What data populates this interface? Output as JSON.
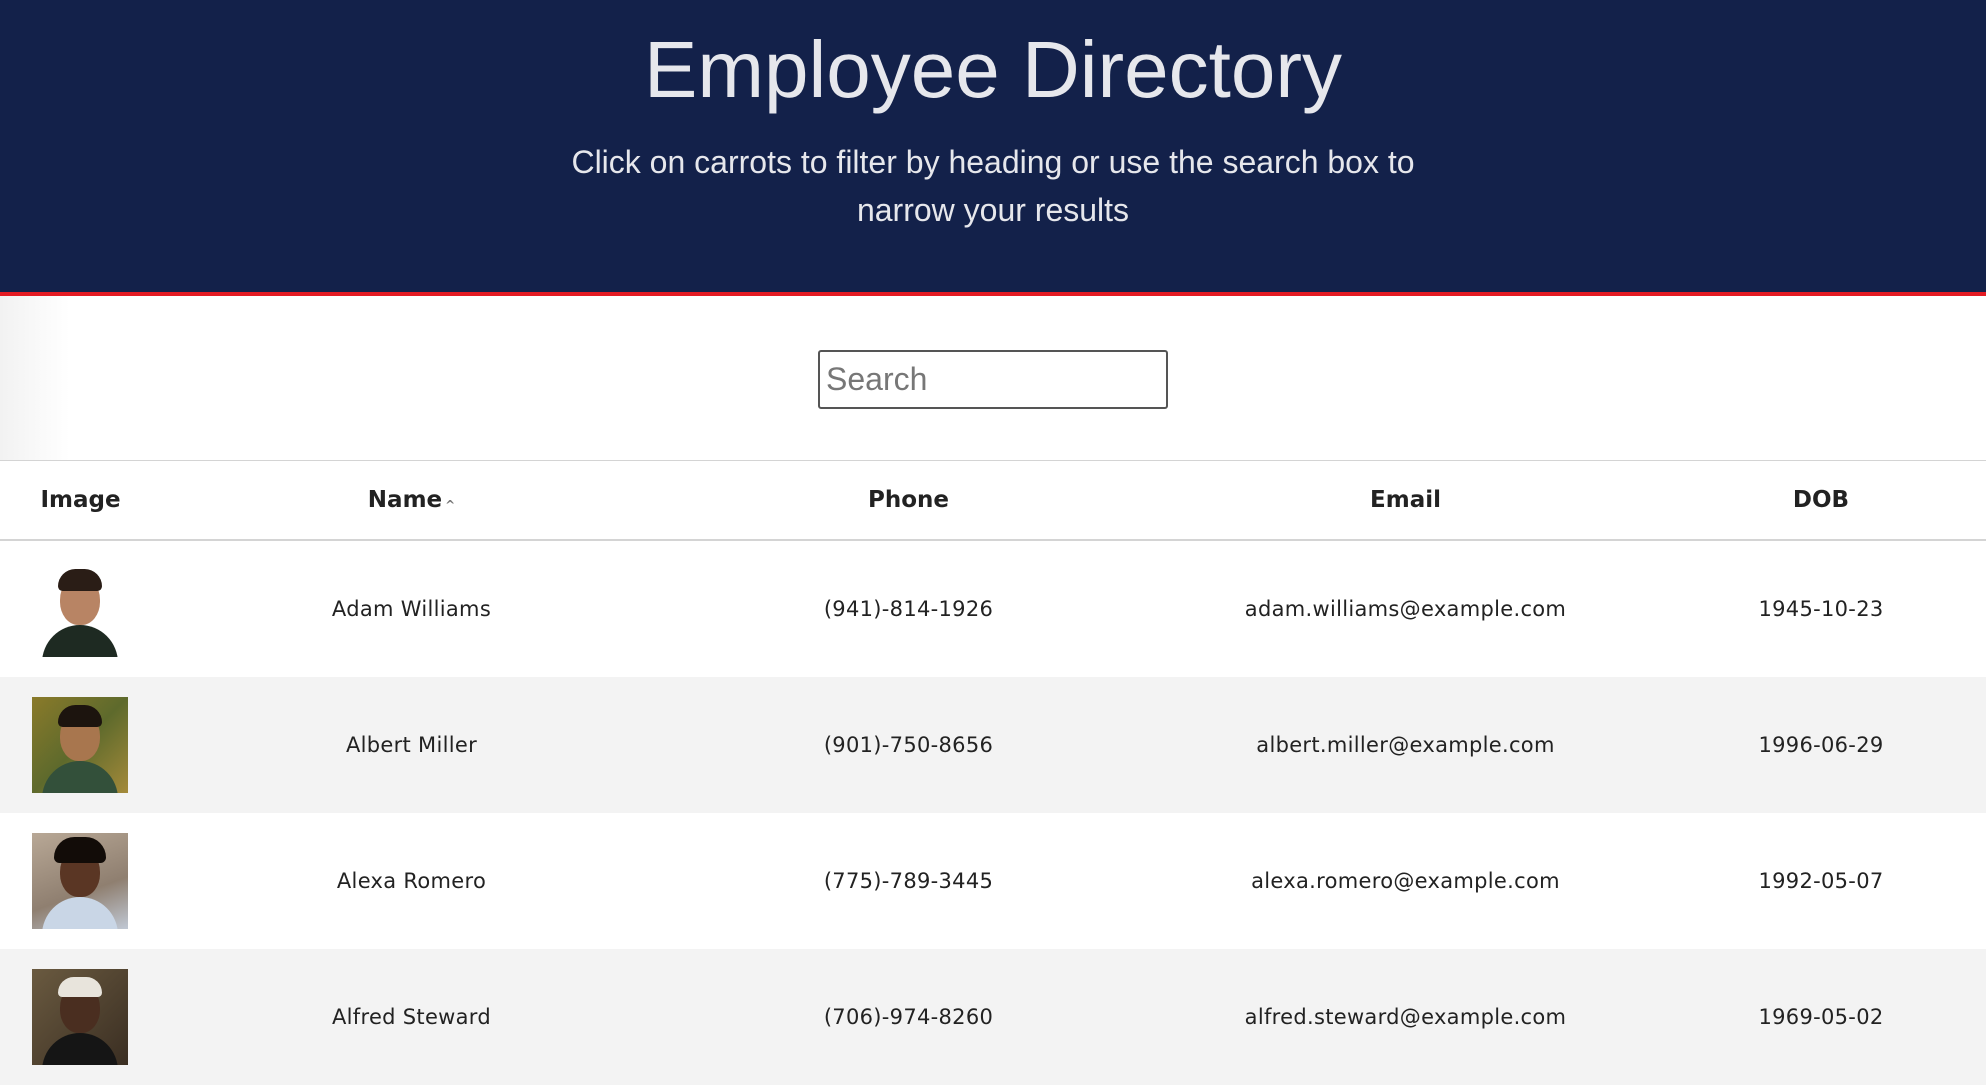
{
  "header": {
    "title": "Employee Directory",
    "subtitle": "Click on carrots to filter by heading or use the search box to narrow your results"
  },
  "search": {
    "placeholder": "Search",
    "value": ""
  },
  "table": {
    "columns": [
      {
        "label": "Image"
      },
      {
        "label": "Name",
        "sort_indicator": "^"
      },
      {
        "label": "Phone"
      },
      {
        "label": "Email"
      },
      {
        "label": "DOB"
      }
    ],
    "rows": [
      {
        "name": "Adam Williams",
        "phone": "(941)-814-1926",
        "email": "adam.williams@example.com",
        "dob": "1945-10-23"
      },
      {
        "name": "Albert Miller",
        "phone": "(901)-750-8656",
        "email": "albert.miller@example.com",
        "dob": "1996-06-29"
      },
      {
        "name": "Alexa Romero",
        "phone": "(775)-789-3445",
        "email": "alexa.romero@example.com",
        "dob": "1992-05-07"
      },
      {
        "name": "Alfred Steward",
        "phone": "(706)-974-8260",
        "email": "alfred.steward@example.com",
        "dob": "1969-05-02"
      }
    ]
  },
  "colors": {
    "header_bg": "#13214a",
    "header_border": "#e41b23",
    "stripe": "#f3f3f3"
  }
}
